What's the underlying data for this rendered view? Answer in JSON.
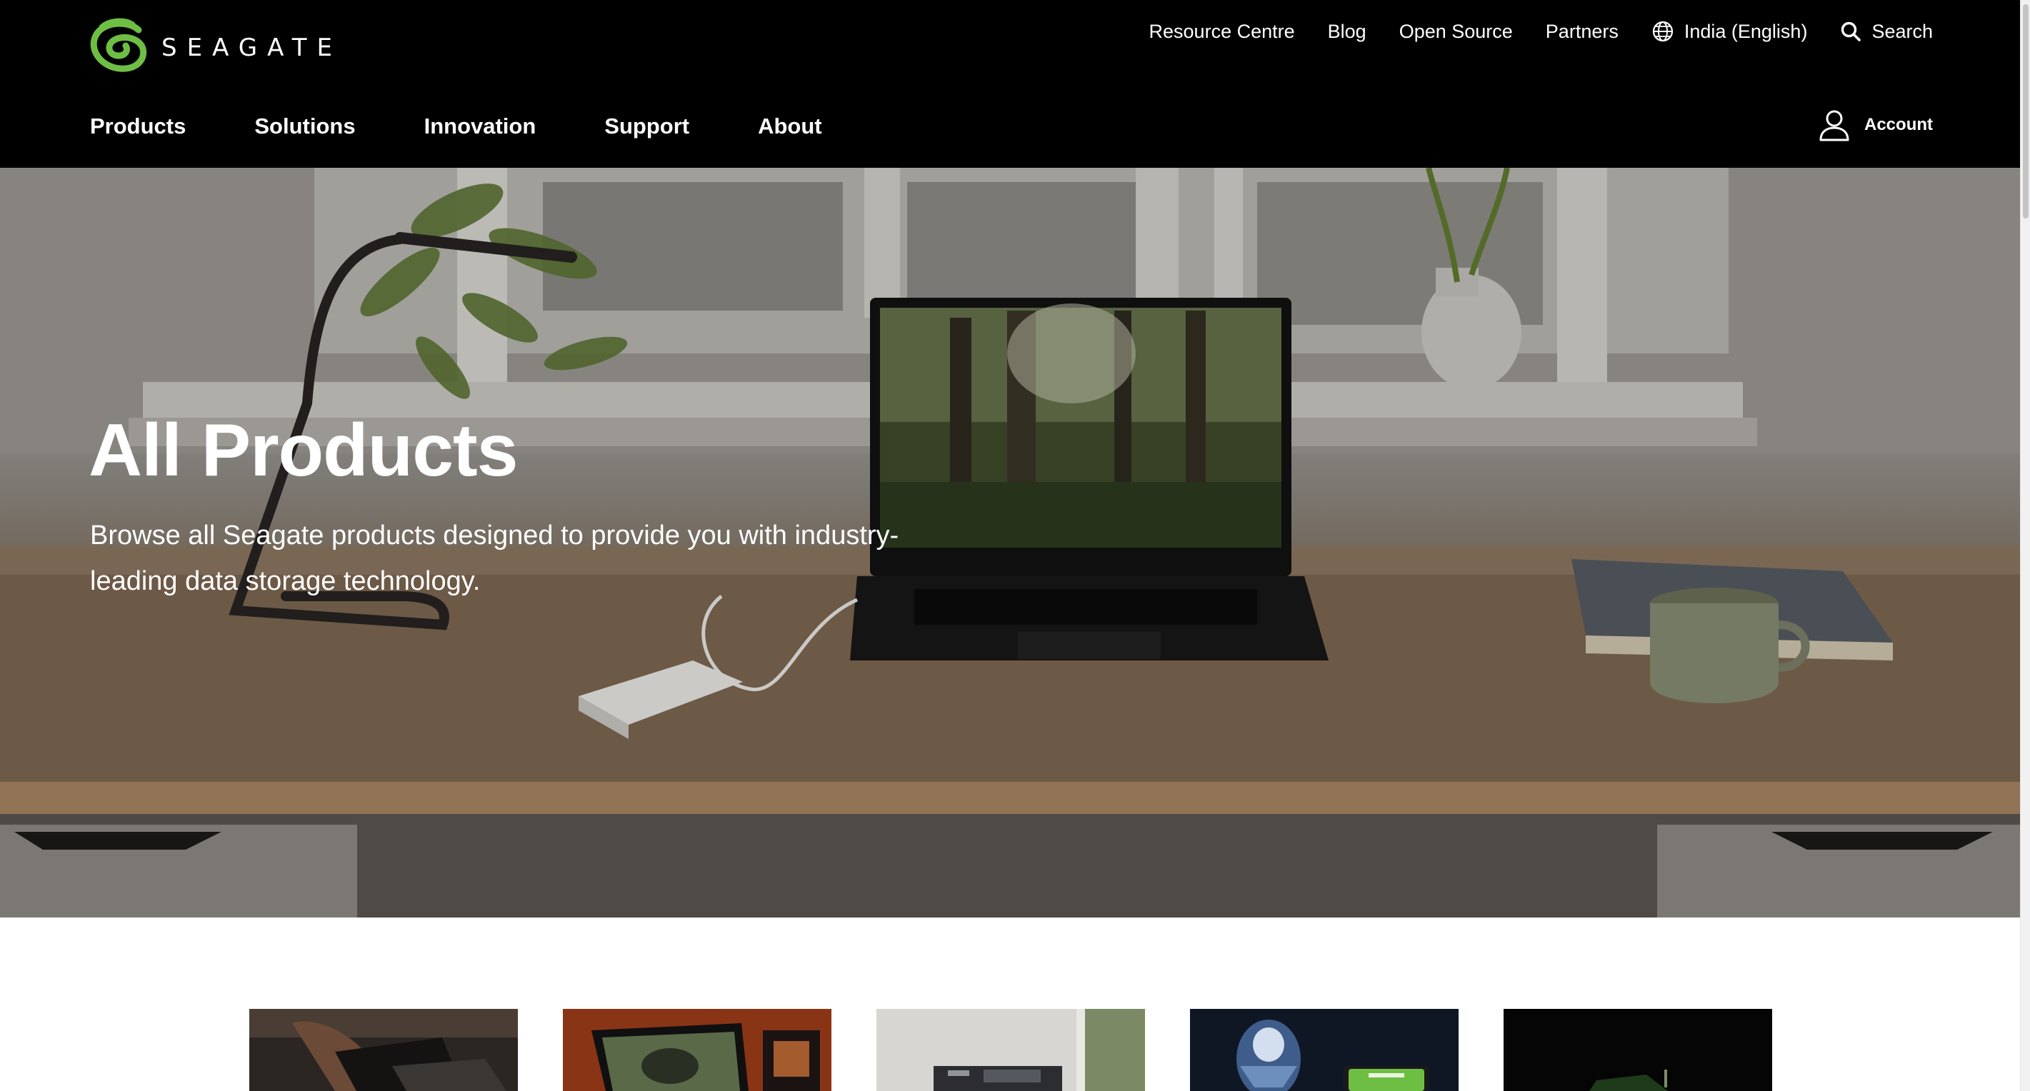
{
  "brand": {
    "name": "SEAGATE",
    "accent_color": "#6ebe44"
  },
  "utility_nav": {
    "items": [
      {
        "label": "Resource Centre"
      },
      {
        "label": "Blog"
      },
      {
        "label": "Open Source"
      },
      {
        "label": "Partners"
      }
    ],
    "region": {
      "label": "India (English)",
      "icon": "globe-icon"
    },
    "search": {
      "label": "Search",
      "icon": "search-icon"
    }
  },
  "main_nav": {
    "items": [
      {
        "label": "Products"
      },
      {
        "label": "Solutions"
      },
      {
        "label": "Innovation"
      },
      {
        "label": "Support"
      },
      {
        "label": "About"
      }
    ]
  },
  "account": {
    "label": "Account",
    "icon": "user-icon"
  },
  "hero": {
    "title": "All Products",
    "description": "Browse all Seagate products designed to provide you with industry-leading data storage technology."
  },
  "category_cards": {
    "count_visible": 5
  }
}
